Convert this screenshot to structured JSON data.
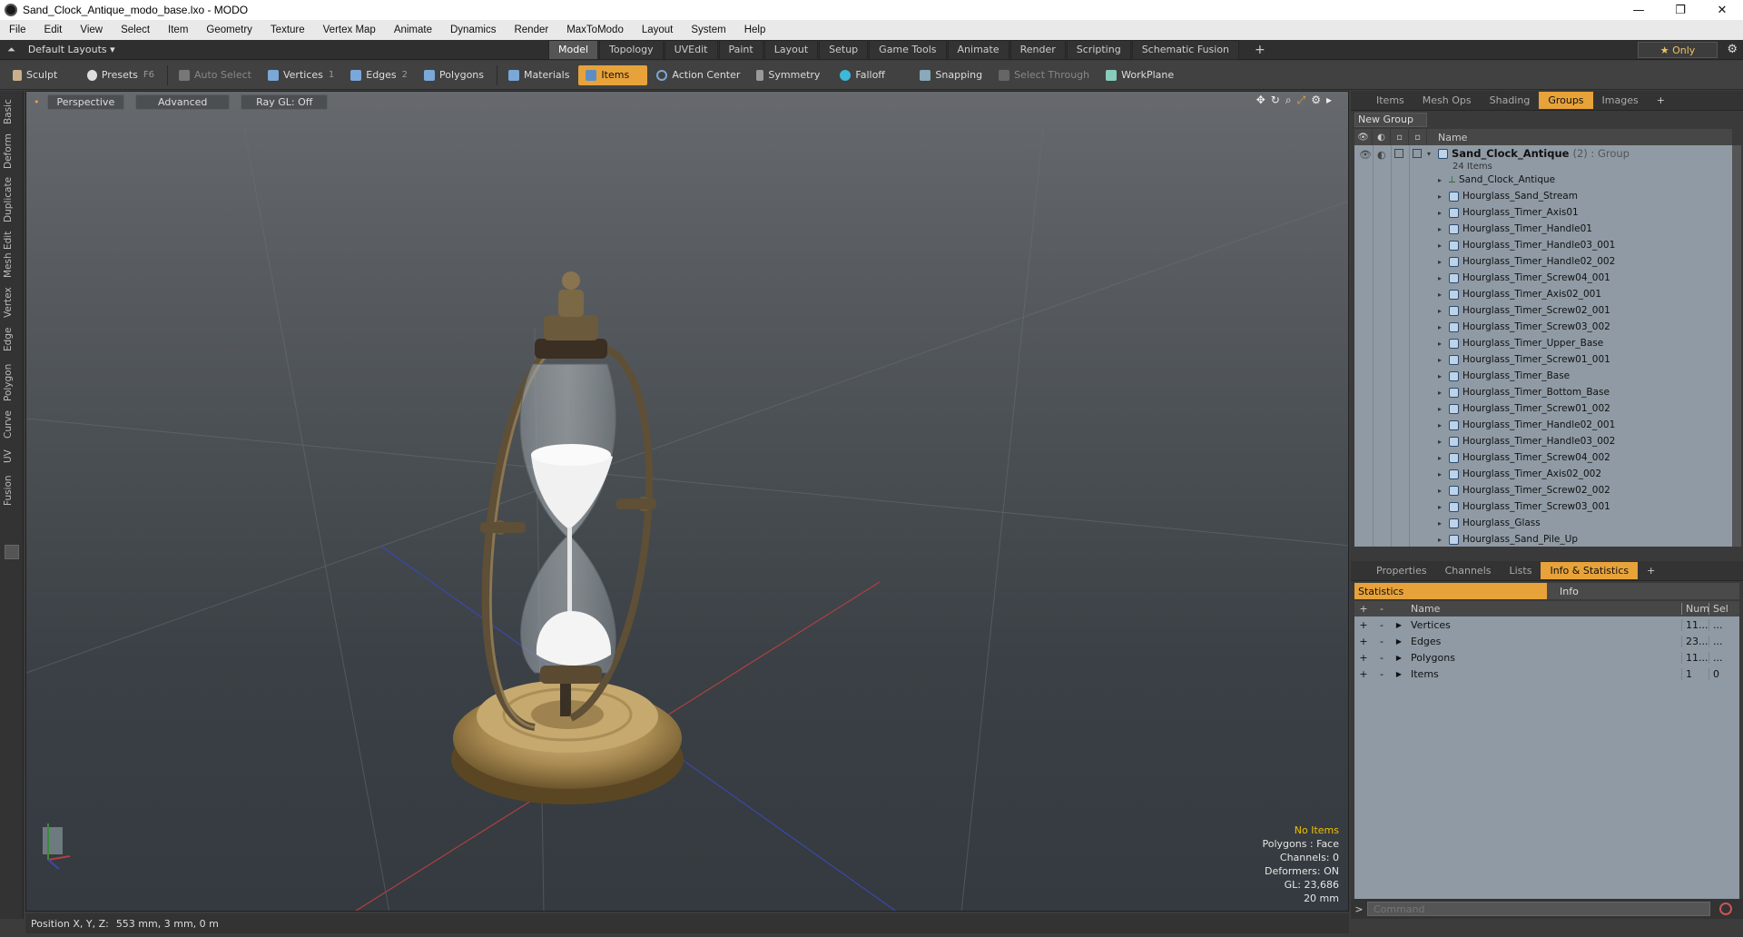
{
  "window": {
    "title": "Sand_Clock_Antique_modo_base.lxo - MODO",
    "minimize": "—",
    "maximize": "❐",
    "close": "✕"
  },
  "menu": [
    "File",
    "Edit",
    "View",
    "Select",
    "Item",
    "Geometry",
    "Texture",
    "Vertex Map",
    "Animate",
    "Dynamics",
    "Render",
    "MaxToModo",
    "Layout",
    "System",
    "Help"
  ],
  "layoutbar": {
    "layouts_label": "Default Layouts ▾",
    "tabs": [
      "Model",
      "Topology",
      "UVEdit",
      "Paint",
      "Layout",
      "Setup",
      "Game Tools",
      "Animate",
      "Render",
      "Scripting",
      "Schematic Fusion"
    ],
    "active_tab": "Model",
    "plus": "+",
    "only_label": "★  Only"
  },
  "toolbar": {
    "sculpt": "Sculpt",
    "presets": "Presets",
    "presets_key": "F6",
    "auto_select": "Auto Select",
    "vertices": "Vertices",
    "vertices_key": "1",
    "edges": "Edges",
    "edges_key": "2",
    "polygons": "Polygons",
    "materials": "Materials",
    "items": "Items",
    "action_center": "Action Center",
    "symmetry": "Symmetry",
    "falloff": "Falloff",
    "snapping": "Snapping",
    "select_through": "Select Through",
    "workplane": "WorkPlane"
  },
  "left_tabs": [
    "Basic",
    "Deform",
    "Duplicate",
    "Mesh Edit",
    "Vertex",
    "Edge",
    "Polygon",
    "Curve",
    "UV",
    "Fusion"
  ],
  "viewport": {
    "view_mode": "Perspective",
    "shading": "Advanced",
    "raygl": "Ray GL: Off",
    "stats": {
      "no_items": "No Items",
      "polygons": "Polygons : Face",
      "channels": "Channels: 0",
      "deformers": "Deformers: ON",
      "gl": "GL: 23,686",
      "scale": "20 mm"
    }
  },
  "items_panel": {
    "tabs": [
      "Items",
      "Mesh Ops",
      "Shading",
      "Groups",
      "Images"
    ],
    "active_tab": "Groups",
    "new_group": "New Group",
    "name_header": "Name",
    "group_name": "Sand_Clock_Antique",
    "group_suffix": "(2) : Group",
    "group_count": "24 Items",
    "locator": "Sand_Clock_Antique",
    "items": [
      "Hourglass_Sand_Stream",
      "Hourglass_Timer_Axis01",
      "Hourglass_Timer_Handle01",
      "Hourglass_Timer_Handle03_001",
      "Hourglass_Timer_Handle02_002",
      "Hourglass_Timer_Screw04_001",
      "Hourglass_Timer_Axis02_001",
      "Hourglass_Timer_Screw02_001",
      "Hourglass_Timer_Screw03_002",
      "Hourglass_Timer_Upper_Base",
      "Hourglass_Timer_Screw01_001",
      "Hourglass_Timer_Base",
      "Hourglass_Timer_Bottom_Base",
      "Hourglass_Timer_Screw01_002",
      "Hourglass_Timer_Handle02_001",
      "Hourglass_Timer_Handle03_002",
      "Hourglass_Timer_Screw04_002",
      "Hourglass_Timer_Axis02_002",
      "Hourglass_Timer_Screw02_002",
      "Hourglass_Timer_Screw03_001",
      "Hourglass_Glass",
      "Hourglass_Sand_Pile_Up"
    ]
  },
  "stats_panel": {
    "tabs": [
      "Properties",
      "Channels",
      "Lists",
      "Info & Statistics"
    ],
    "active_tab": "Info & Statistics",
    "statistics": "Statistics",
    "info": "Info",
    "headers": {
      "name": "Name",
      "num": "Num",
      "sel": "Sel"
    },
    "rows": [
      {
        "name": "Vertices",
        "num": "11...",
        "sel": "..."
      },
      {
        "name": "Edges",
        "num": "23...",
        "sel": "..."
      },
      {
        "name": "Polygons",
        "num": "11...",
        "sel": "..."
      },
      {
        "name": "Items",
        "num": "1",
        "sel": "0"
      }
    ],
    "command_placeholder": "Command"
  },
  "status": {
    "position_label": "Position X, Y, Z:",
    "position_value": "553 mm, 3 mm, 0 m"
  }
}
